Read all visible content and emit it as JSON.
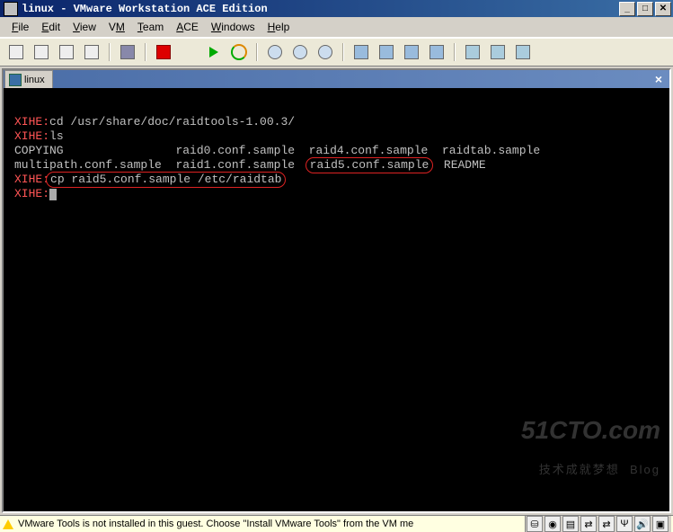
{
  "title": "linux - VMware Workstation ACE Edition",
  "menu": {
    "file": "File",
    "edit": "Edit",
    "view": "View",
    "vm": "VM",
    "team": "Team",
    "ace": "ACE",
    "windows": "Windows",
    "help": "Help"
  },
  "tab": {
    "label": "linux"
  },
  "terminal": {
    "line1_prompt": "XIHE:",
    "line1_cmd": "cd /usr/share/doc/raidtools-1.00.3/",
    "line2_prompt": "XIHE:",
    "line2_cmd": "ls",
    "line3_col1": "COPYING",
    "line3_col2": "raid0.conf.sample",
    "line3_col3": "raid4.conf.sample",
    "line3_col4": "raidtab.sample",
    "line4_col1": "multipath.conf.sample",
    "line4_col2": "raid1.conf.sample",
    "line4_col3": "raid5.conf.sample",
    "line4_col4": "README",
    "line5_prompt": "XIHE:",
    "line5_cmd": "cp raid5.conf.sample /etc/raidtab",
    "line6_prompt": "XIHE:"
  },
  "status": {
    "text": "VMware Tools is not installed in this guest. Choose \"Install VMware Tools\" from the VM me"
  },
  "watermark": {
    "big": "51CTO.com",
    "small": "技术成就梦想  Blog"
  }
}
